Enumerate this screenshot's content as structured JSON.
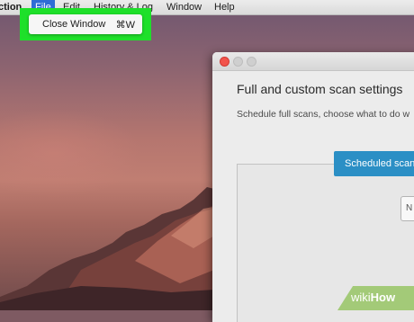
{
  "menubar": {
    "app_name": "ction",
    "items": [
      "File",
      "Edit",
      "History & Log",
      "Window",
      "Help"
    ]
  },
  "file_menu": {
    "item_label": "Close Window",
    "item_shortcut": "⌘W"
  },
  "window": {
    "heading": "Full and custom scan settings",
    "subtext": "Schedule full scans, choose what to do w",
    "tab_label": "Scheduled scan",
    "field_fragment": "N"
  },
  "watermark": {
    "prefix": "wiki",
    "suffix": "How"
  },
  "colors": {
    "highlight": "#1ee02a",
    "menu_selected": "#2f6cd6",
    "accent_button": "#2b8fc5",
    "close_button": "#f2544c"
  }
}
